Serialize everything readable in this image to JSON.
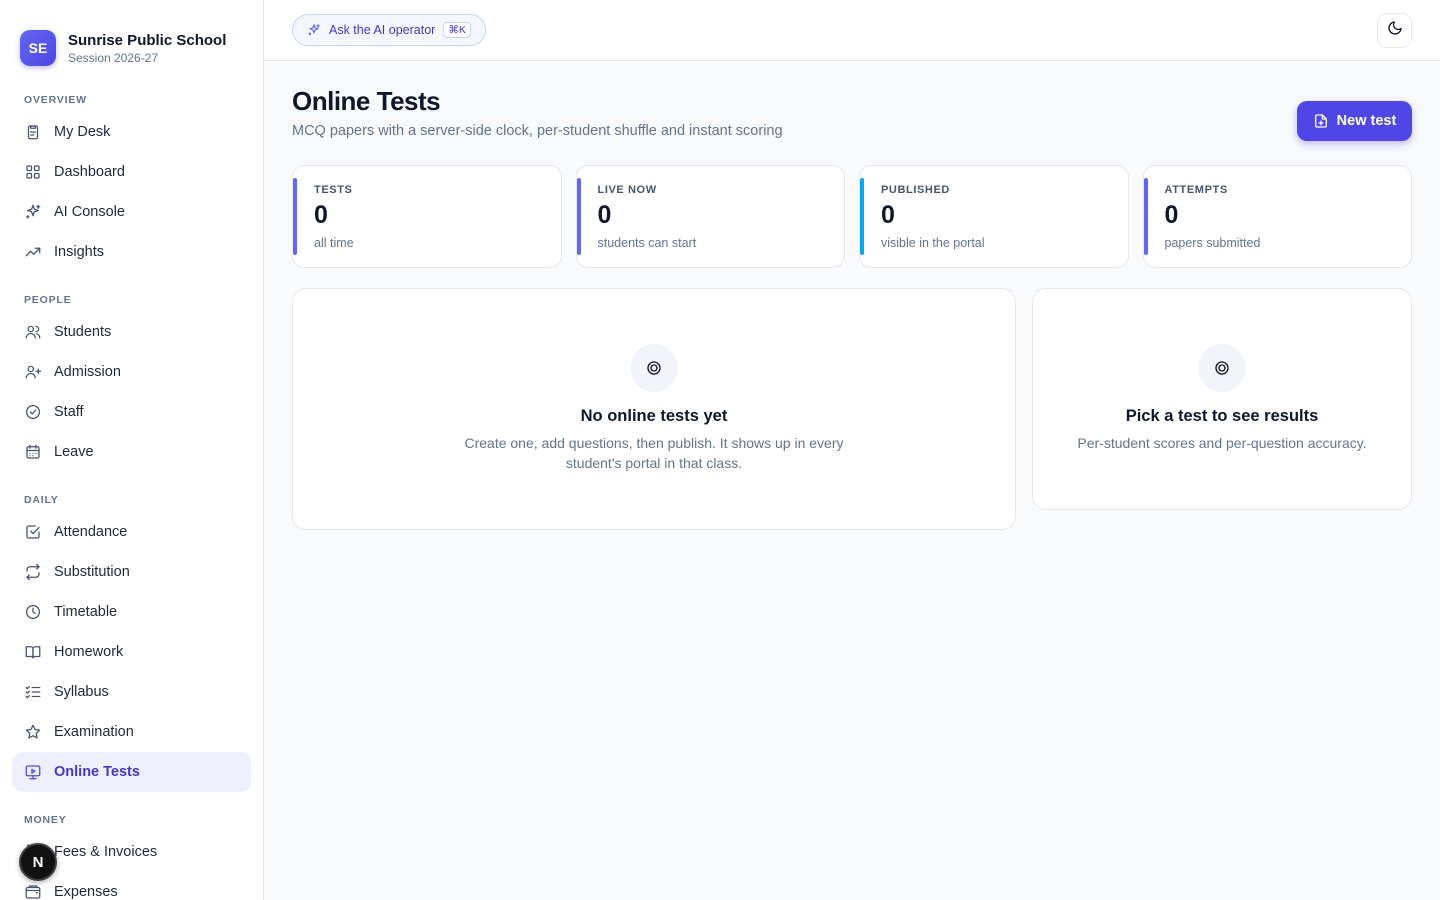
{
  "brand": {
    "initials": "SE",
    "name": "Sunrise Public School",
    "session": "Session 2026-27"
  },
  "sidebar": {
    "sections": [
      {
        "label": "OVERVIEW",
        "items": [
          {
            "label": "My Desk",
            "icon": "clipboard-icon"
          },
          {
            "label": "Dashboard",
            "icon": "grid-icon"
          },
          {
            "label": "AI Console",
            "icon": "sparkles-icon"
          },
          {
            "label": "Insights",
            "icon": "trending-up-icon"
          }
        ]
      },
      {
        "label": "PEOPLE",
        "items": [
          {
            "label": "Students",
            "icon": "users-icon"
          },
          {
            "label": "Admission",
            "icon": "user-plus-icon"
          },
          {
            "label": "Staff",
            "icon": "check-circle-icon"
          },
          {
            "label": "Leave",
            "icon": "calendar-icon"
          }
        ]
      },
      {
        "label": "DAILY",
        "items": [
          {
            "label": "Attendance",
            "icon": "check-square-icon"
          },
          {
            "label": "Substitution",
            "icon": "repeat-icon"
          },
          {
            "label": "Timetable",
            "icon": "clock-icon"
          },
          {
            "label": "Homework",
            "icon": "book-open-icon"
          },
          {
            "label": "Syllabus",
            "icon": "list-checks-icon"
          },
          {
            "label": "Examination",
            "icon": "star-icon"
          },
          {
            "label": "Online Tests",
            "icon": "monitor-play-icon",
            "active": true
          }
        ]
      },
      {
        "label": "MONEY",
        "items": [
          {
            "label": "Fees & Invoices",
            "icon": "receipt-icon"
          },
          {
            "label": "Expenses",
            "icon": "wallet-icon"
          }
        ]
      }
    ]
  },
  "fab": {
    "label": "N"
  },
  "topbar": {
    "ai_label": "Ask the AI operator",
    "shortcut": "⌘K",
    "theme_icon": "moon-icon"
  },
  "page": {
    "title": "Online Tests",
    "subtitle": "MCQ papers with a server-side clock, per-student shuffle and instant scoring",
    "new_button": "New test"
  },
  "stats": [
    {
      "label": "TESTS",
      "value": "0",
      "note": "all time",
      "color": "#6366f1"
    },
    {
      "label": "LIVE NOW",
      "value": "0",
      "note": "students can start",
      "color": "#6366f1"
    },
    {
      "label": "PUBLISHED",
      "value": "0",
      "note": "visible in the portal",
      "color": "#0ea5e9"
    },
    {
      "label": "ATTEMPTS",
      "value": "0",
      "note": "papers submitted",
      "color": "#6366f1"
    }
  ],
  "empty_tests": {
    "title": "No online tests yet",
    "description": "Create one, add questions, then publish. It shows up in every student's portal in that class."
  },
  "results_panel": {
    "title": "Pick a test to see results",
    "description": "Per-student scores and per-question accuracy."
  },
  "colors": {
    "accent": "#4f46e5",
    "active_bg": "#eef0fd"
  }
}
